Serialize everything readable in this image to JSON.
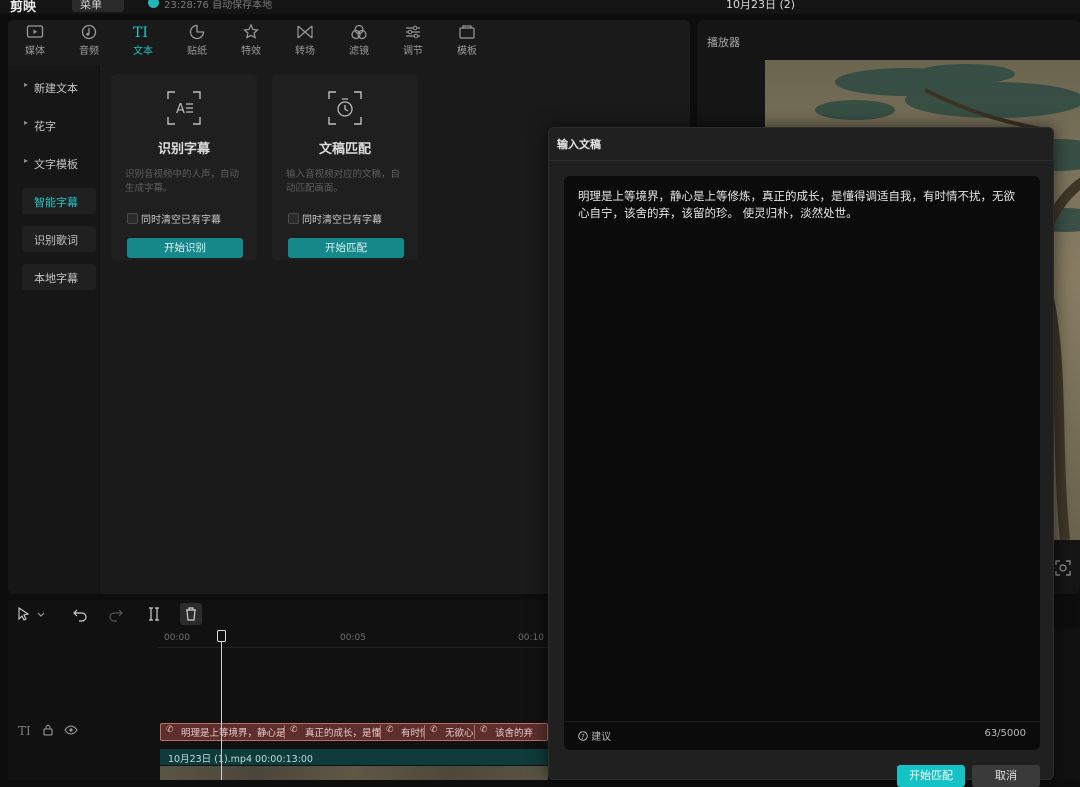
{
  "topbar": {
    "logo": "剪映",
    "menu": "菜单",
    "save_status": "23:28:76 自动保存本地",
    "project_title": "10月23日 (2)"
  },
  "tabs": [
    {
      "label": "媒体",
      "icon": "media-icon"
    },
    {
      "label": "音频",
      "icon": "audio-icon"
    },
    {
      "label": "文本",
      "icon": "text-icon",
      "active": true
    },
    {
      "label": "贴纸",
      "icon": "sticker-icon"
    },
    {
      "label": "特效",
      "icon": "effects-icon"
    },
    {
      "label": "转场",
      "icon": "transition-icon"
    },
    {
      "label": "滤镜",
      "icon": "filter-icon"
    },
    {
      "label": "调节",
      "icon": "adjust-icon"
    },
    {
      "label": "模板",
      "icon": "template-icon"
    }
  ],
  "subnav": {
    "items": [
      "新建文本",
      "花字",
      "文字模板",
      "智能字幕",
      "识别歌词",
      "本地字幕"
    ],
    "active": "智能字幕"
  },
  "cards": [
    {
      "title": "识别字幕",
      "desc": "识别音视频中的人声，自动生成字幕。",
      "checkbox": "同时清空已有字幕",
      "button": "开始识别",
      "icon": "subtitle-recognize-icon"
    },
    {
      "title": "文稿匹配",
      "desc": "输入音视频对应的文稿，自动匹配画面。",
      "checkbox": "同时清空已有字幕",
      "button": "开始匹配",
      "icon": "script-match-icon"
    }
  ],
  "player": {
    "title": "播放器"
  },
  "timeline": {
    "ruler": [
      "00:00",
      "00:05",
      "00:10"
    ],
    "subtitle_segments": [
      "明理是上等境界，静心是上等修炼",
      "真正的成长，是懂得调适自我",
      "有时情不扰",
      "无欲心自宁",
      "该舍的弃"
    ],
    "video_label": "10月23日 (1).mp4   00:00:13:00"
  },
  "dialog": {
    "title": "输入文稿",
    "content": "明理是上等境界，静心是上等修炼，真正的成长，是懂得调适自我，有时情不扰，无欲心自宁，该舍的弃，该留的珍。 使灵归朴，淡然处世。",
    "hint": "建议",
    "count": "63/5000",
    "confirm": "开始匹配",
    "cancel": "取消"
  },
  "colors": {
    "accent": "#15c3c6",
    "subtitle_track": "#5d2e2b",
    "video_track": "#0f3b3a"
  }
}
